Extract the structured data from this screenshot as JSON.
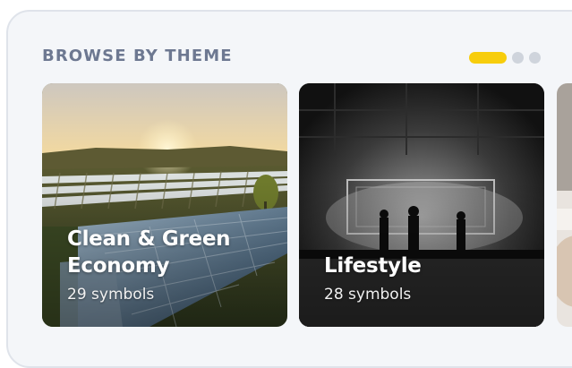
{
  "section": {
    "title": "BROWSE BY THEME"
  },
  "pager": {
    "pages": 3,
    "active_index": 0,
    "active_color": "#f7cd0c",
    "inactive_color": "#cfd4dc"
  },
  "themes": [
    {
      "title": "Clean & Green Economy",
      "count": "29 symbols",
      "image": "solar-farm-sunset-photo"
    },
    {
      "title": "Lifestyle",
      "count": "28 symbols",
      "image": "concert-stage-bw-photo"
    },
    {
      "title": "",
      "count": "",
      "image": "partial-photo"
    }
  ]
}
